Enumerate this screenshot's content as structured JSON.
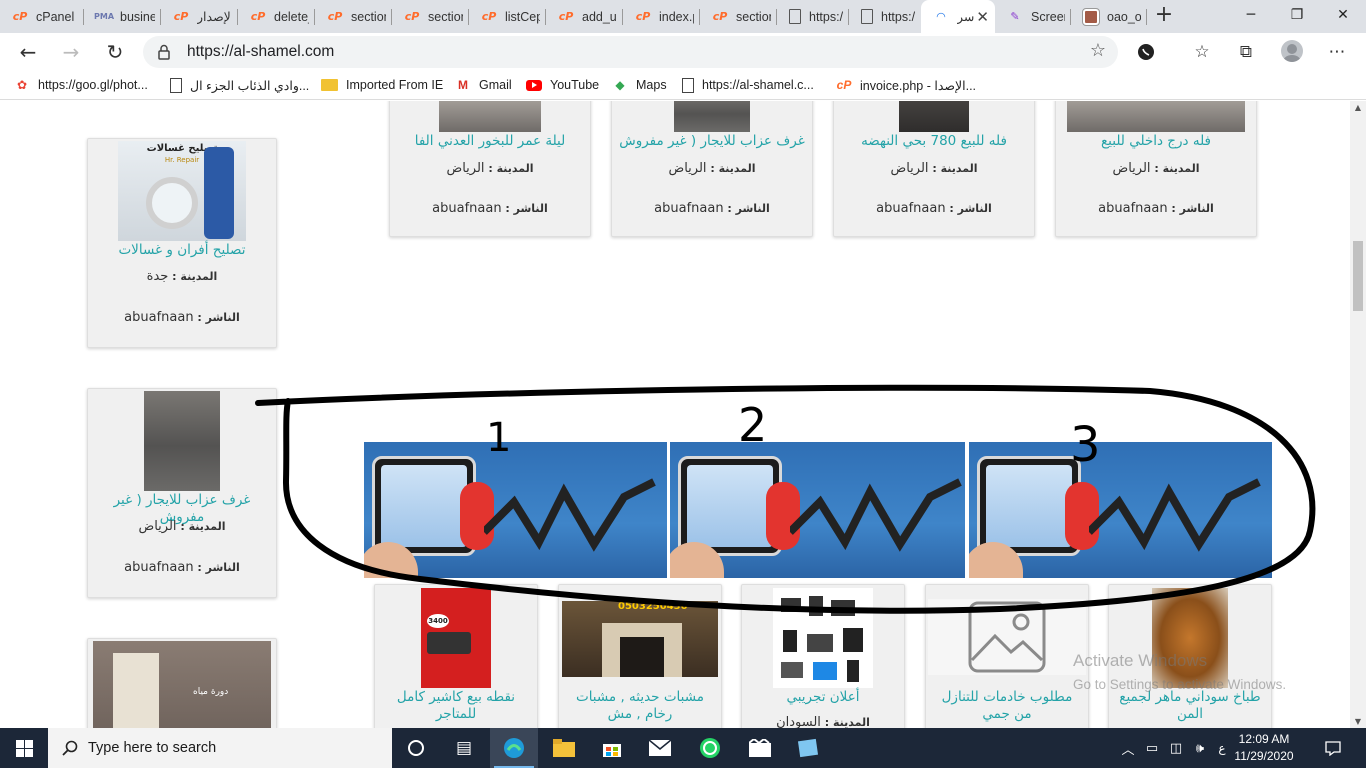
{
  "tabs": [
    {
      "title": "cPanel",
      "icon": "cpanel-icon"
    },
    {
      "title": "busine",
      "icon": "phpmyadmin-icon"
    },
    {
      "title": "الإصدار",
      "icon": "cpanel-icon"
    },
    {
      "title": "delete_",
      "icon": "cpanel-icon"
    },
    {
      "title": "section",
      "icon": "cpanel-icon"
    },
    {
      "title": "section",
      "icon": "cpanel-icon"
    },
    {
      "title": "listCep",
      "icon": "cpanel-icon"
    },
    {
      "title": "add_us",
      "icon": "cpanel-icon"
    },
    {
      "title": "index.p",
      "icon": "cpanel-icon"
    },
    {
      "title": "section",
      "icon": "cpanel-icon"
    },
    {
      "title": "https://",
      "icon": "page-icon"
    },
    {
      "title": "https://",
      "icon": "page-icon"
    },
    {
      "title": "سر",
      "icon": "site-logo-icon",
      "active": true
    },
    {
      "title": "Screen",
      "icon": "feather-icon"
    },
    {
      "title": "oao_oa",
      "icon": "image-icon"
    }
  ],
  "address_bar": {
    "url": "https://al-shamel.com"
  },
  "bookmarks": [
    {
      "label": "https://goo.gl/phot...",
      "icon": "photos-icon"
    },
    {
      "label": "وادي الذئاب الجزء ال...",
      "icon": "page-icon"
    },
    {
      "label": "Imported From IE",
      "icon": "folder-icon"
    },
    {
      "label": "Gmail",
      "icon": "gmail-icon"
    },
    {
      "label": "YouTube",
      "icon": "youtube-icon"
    },
    {
      "label": "Maps",
      "icon": "maps-icon"
    },
    {
      "label": "https://al-shamel.c...",
      "icon": "page-icon"
    },
    {
      "label": "invoice.php - الإصدا...",
      "icon": "cpanel-icon"
    }
  ],
  "listing_labels": {
    "city": "المدينة",
    "publisher": "الناشر"
  },
  "listings": {
    "top_row": [
      {
        "title": "ليلة عمر للبخور العدني الفا",
        "city": "الرياض",
        "publisher": "abuafnaan"
      },
      {
        "title": "غرف عزاب للايجار ( غير مفروش",
        "city": "الرياض",
        "publisher": "abuafnaan"
      },
      {
        "title": "فله للبيع 780 بحي النهضه",
        "city": "الرياض",
        "publisher": "abuafnaan"
      },
      {
        "title": "فله درج داخلي للبيع",
        "city": "الرياض",
        "publisher": "abuafnaan"
      }
    ],
    "sidebar": [
      {
        "title": "تصليح أفران و غسالات",
        "city": "جدة",
        "publisher": "abuafnaan",
        "image_caption": "تصليح غسالات",
        "image_sub": "Hr. Repair"
      },
      {
        "title": "غرف عزاب للايجار ( غير مفروش",
        "city": "الرياض",
        "publisher": "abuafnaan"
      },
      {
        "title": "",
        "image_caption": "دورة مياه"
      }
    ],
    "bottom_row": [
      {
        "title": "نقطه بيع كاشير كامل للمتاجر",
        "image_caption": "3400"
      },
      {
        "title": "مشبات حديثه , مشبات رخام , مش",
        "image_caption": "0503250430"
      },
      {
        "title": "أعلان تجريبي",
        "city": "السودان"
      },
      {
        "title": "مطلوب خادمات للتنازل من جمي"
      },
      {
        "title": "طباخ سوداني ماهر لجميع المن"
      }
    ]
  },
  "banner_annotations": [
    "1",
    "2",
    "3"
  ],
  "watermark": {
    "line1": "Activate Windows",
    "line2": "Go to Settings to activate Windows."
  },
  "taskbar": {
    "search_placeholder": "Type here to search",
    "time": "12:09 AM",
    "date": "11/29/2020",
    "language": "ع"
  },
  "colors": {
    "link_teal": "#24a3a8",
    "taskbar": "#1c2738",
    "tab_strip": "#dee1e6"
  }
}
